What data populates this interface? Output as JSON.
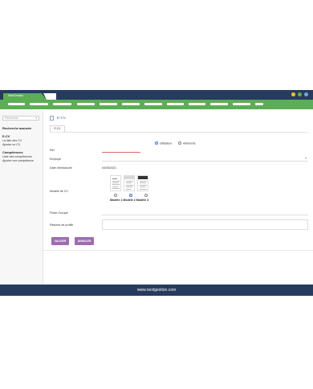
{
  "browser": {
    "tab_label": "NextGestion",
    "window_dots": [
      "#f1c232",
      "#6aa84f",
      "#6fa8dc"
    ]
  },
  "sidebar": {
    "search_placeholder": "Recherche",
    "search_caret": "▾",
    "advanced_search": "Recherche avancée",
    "ecv_heading": "E-CV",
    "ecv_items": [
      "La liste des CV",
      "Ajouter un CV"
    ],
    "skills_heading": "Compétences",
    "skills_items": [
      "Liste des compétences",
      "Ajouter une compétence"
    ]
  },
  "main": {
    "page_title": "E-CV",
    "form_tab": "E-CV",
    "radio_options": [
      {
        "label": "Utilisateur",
        "selected": true
      },
      {
        "label": "Adhérents",
        "selected": false
      }
    ],
    "fields": {
      "ref": "Ref",
      "employee": "Employé",
      "hire_date": "Date d'embauche",
      "hire_date_value": "04/05/2021",
      "cv_model": "Modèle de CV",
      "models_caption": "Modèle 1 Modèle 2 Modèle 3",
      "position": "Poste Occupé",
      "profile_summary": "Résumé de profile"
    },
    "select_caret": "▾",
    "buttons": {
      "validate": "VALIDER",
      "cancel": "ANNULER"
    }
  },
  "footer": {
    "text": "www.nextgestion.com"
  },
  "colors": {
    "navy": "#263b5e",
    "green": "#5cad55",
    "button": "#a06bb0",
    "link": "#4a6fa5"
  }
}
